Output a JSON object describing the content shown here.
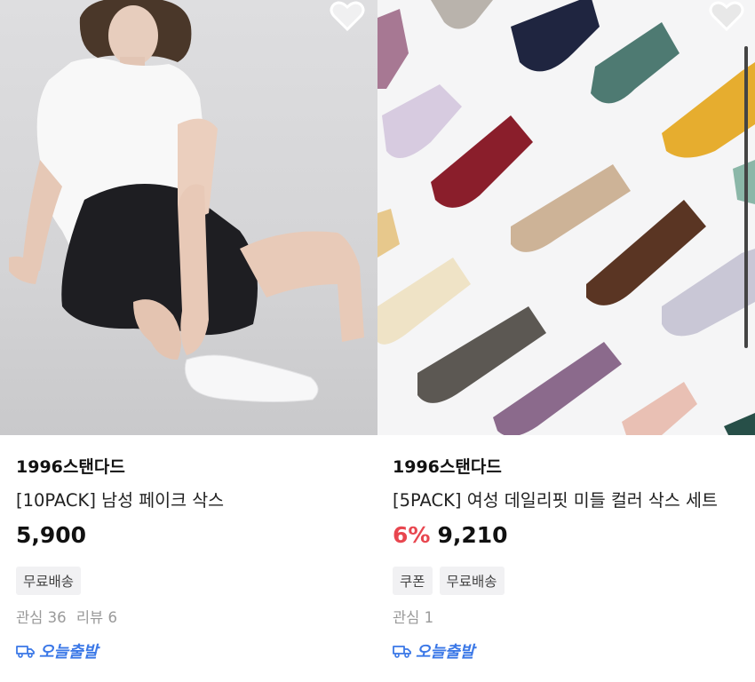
{
  "products": [
    {
      "image_alt": "man sitting wearing white fake socks",
      "brand": "1996스탠다드",
      "title": "[10PACK] 남성 페이크 삭스",
      "discount": "",
      "price": "5,900",
      "tags": [
        "무료배송"
      ],
      "meta": [
        "관심 36",
        "리뷰 6"
      ],
      "shipping": "오늘출발",
      "wishlist_icon": "heart-outline-icon",
      "shipping_icon": "truck-icon"
    },
    {
      "image_alt": "assorted colored crew socks",
      "brand": "1996스탠다드",
      "title": "[5PACK] 여성 데일리핏 미들 컬러 삭스 세트",
      "discount": "6%",
      "price": "9,210",
      "tags": [
        "쿠폰",
        "무료배송"
      ],
      "meta": [
        "관심 1"
      ],
      "shipping": "오늘출발",
      "wishlist_icon": "heart-outline-icon",
      "shipping_icon": "truck-icon"
    }
  ],
  "colors": {
    "discount": "#e8464f",
    "shipping": "#3b78e7",
    "tag_bg": "#f1f1f3",
    "meta_text": "#9a9a9a"
  }
}
